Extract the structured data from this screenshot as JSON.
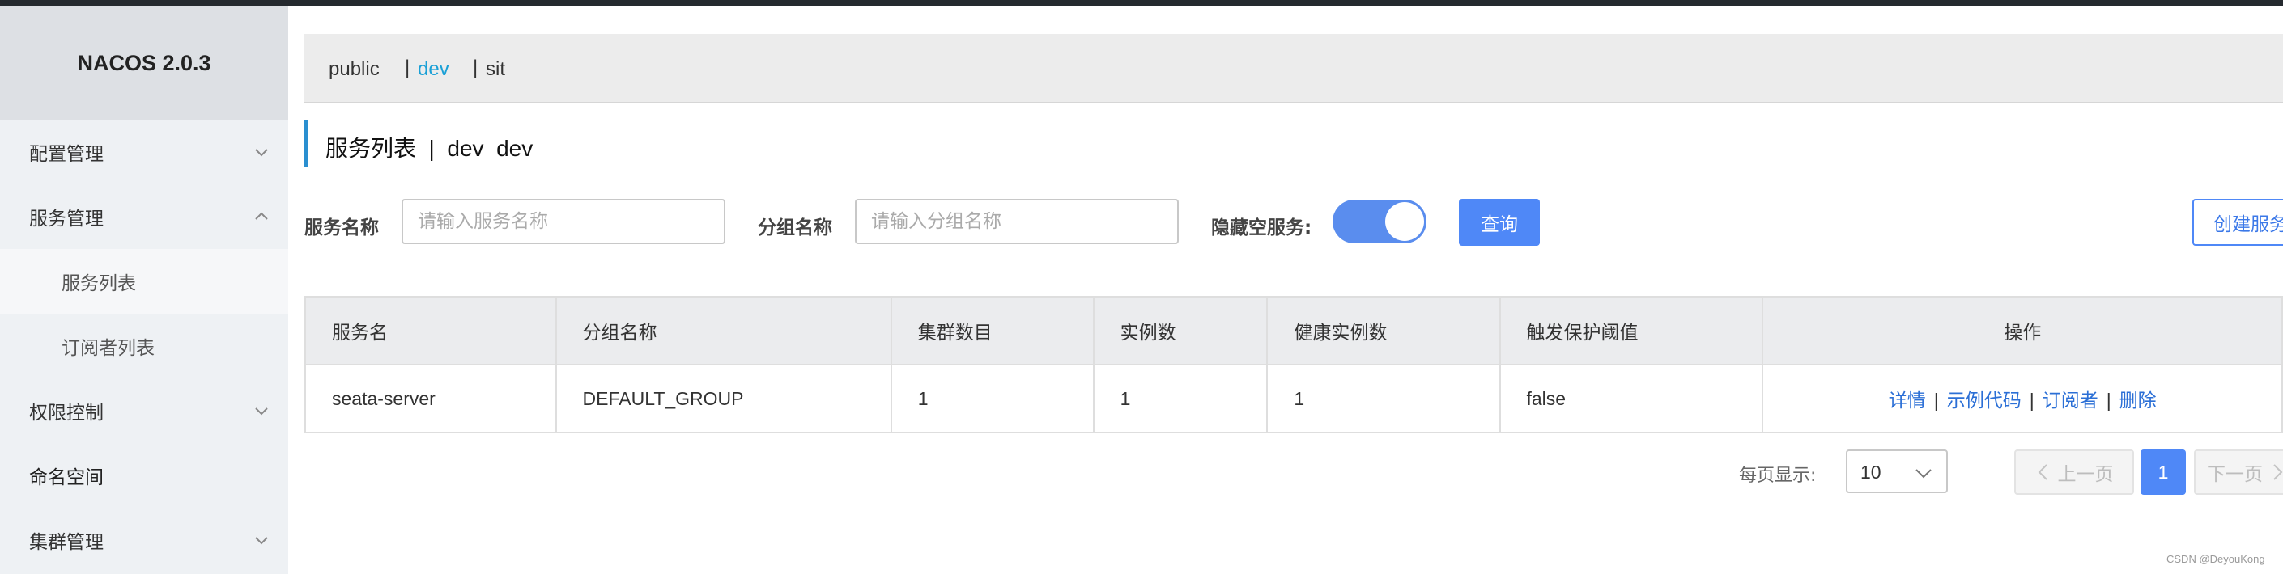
{
  "app": {
    "brand": "NACOS 2.0.3"
  },
  "sidebar": {
    "items": [
      {
        "label": "配置管理",
        "chevron": "down"
      },
      {
        "label": "服务管理",
        "chevron": "up"
      },
      {
        "label": "服务列表",
        "sub": true,
        "active": true
      },
      {
        "label": "订阅者列表",
        "sub": true
      },
      {
        "label": "权限控制",
        "chevron": "down"
      },
      {
        "label": "命名空间"
      },
      {
        "label": "集群管理",
        "chevron": "down"
      }
    ]
  },
  "namespaces": {
    "items": [
      "public",
      "dev",
      "sit"
    ],
    "separator": "|",
    "active": "dev",
    "active_color": "#1aa0d6"
  },
  "page": {
    "title": "服务列表  |  dev  dev"
  },
  "filters": {
    "service_name_label": "服务名称",
    "service_name_placeholder": "请输入服务名称",
    "group_name_label": "分组名称",
    "group_name_placeholder": "请输入分组名称",
    "hide_empty_label": "隐藏空服务:",
    "hide_empty_on": true,
    "query_button": "查询",
    "create_button": "创建服务"
  },
  "table": {
    "headers": [
      "服务名",
      "分组名称",
      "集群数目",
      "实例数",
      "健康实例数",
      "触发保护阈值",
      "操作"
    ],
    "rows": [
      {
        "cells": [
          "seata-server",
          "DEFAULT_GROUP",
          "1",
          "1",
          "1",
          "false"
        ],
        "actions": [
          "详情",
          "示例代码",
          "订阅者",
          "删除"
        ]
      }
    ]
  },
  "pagination": {
    "page_size_label": "每页显示:",
    "page_size": "10",
    "prev": "上一页",
    "current": "1",
    "next": "下一页"
  },
  "watermark": "CSDN @DeyouKong",
  "colors": {
    "accent": "#4f88f7",
    "sidebar_bg": "#eef1f4",
    "link": "#2b6fd6"
  }
}
